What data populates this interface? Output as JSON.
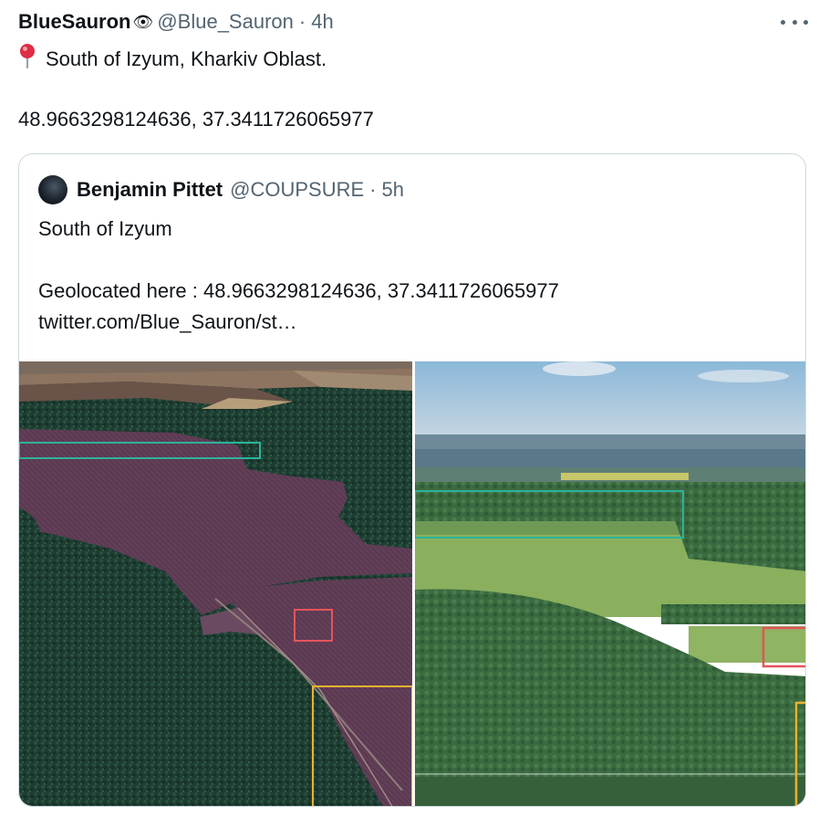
{
  "tweet": {
    "author_name": "BlueSauron",
    "author_emoji": "👁",
    "handle": "@Blue_Sauron",
    "separator": "·",
    "time": "4h",
    "location_text": "South of Izyum, Kharkiv Oblast.",
    "coordinates": "48.9663298124636, 37.3411726065977"
  },
  "quote": {
    "author_name": "Benjamin Pittet",
    "handle": "@COUPSURE",
    "separator": "·",
    "time": "5h",
    "line1": "South of Izyum",
    "line2": "Geolocated here : 48.9663298124636, 37.3411726065977",
    "link": "twitter.com/Blue_Sauron/st…"
  },
  "media": {
    "left_image": "satellite-view",
    "right_image": "aerial-video-still",
    "box_colors": {
      "teal": "#2bb39a",
      "red": "#e4545a",
      "yellow": "#e8b330"
    }
  },
  "icons": {
    "more": "more-options-icon",
    "pin": "round-pushpin-icon"
  }
}
